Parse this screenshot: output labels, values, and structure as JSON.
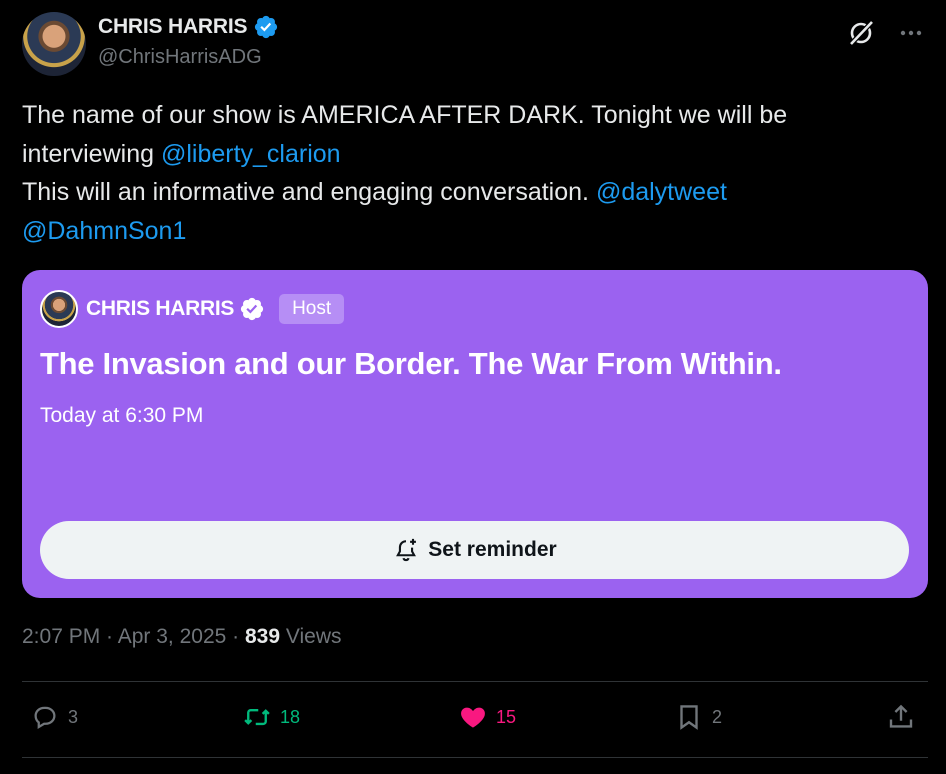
{
  "author": {
    "display_name": "CHRIS HARRIS",
    "handle": "@ChrisHarrisADG",
    "verified_color": "#1d9bf0"
  },
  "tweet": {
    "line1": "The name of our show is AMERICA AFTER DARK. Tonight we will be",
    "line2_prefix": "interviewing ",
    "mention1": "@liberty_clarion",
    "line3": "This will an informative and engaging conversation. ",
    "mention2": "@dalytweet",
    "mention3": "@DahmnSon1"
  },
  "space_card": {
    "host_name": "CHRIS HARRIS",
    "host_badge": "Host",
    "title": "The Invasion and our Border. The War From Within.",
    "time": "Today at 6:30 PM",
    "reminder_label": "Set reminder",
    "background_color": "#9b62f0"
  },
  "meta": {
    "time": "2:07 PM",
    "separator": " · ",
    "date": "Apr 3, 2025",
    "views_count": "839",
    "views_label": " Views"
  },
  "actions": {
    "replies": "3",
    "retweets": "18",
    "likes": "15",
    "bookmarks": "2"
  },
  "icons": [
    "grok-icon",
    "more-icon",
    "verified-icon",
    "bell-plus-icon",
    "reply-icon",
    "retweet-icon",
    "like-icon",
    "bookmark-icon",
    "share-icon"
  ]
}
